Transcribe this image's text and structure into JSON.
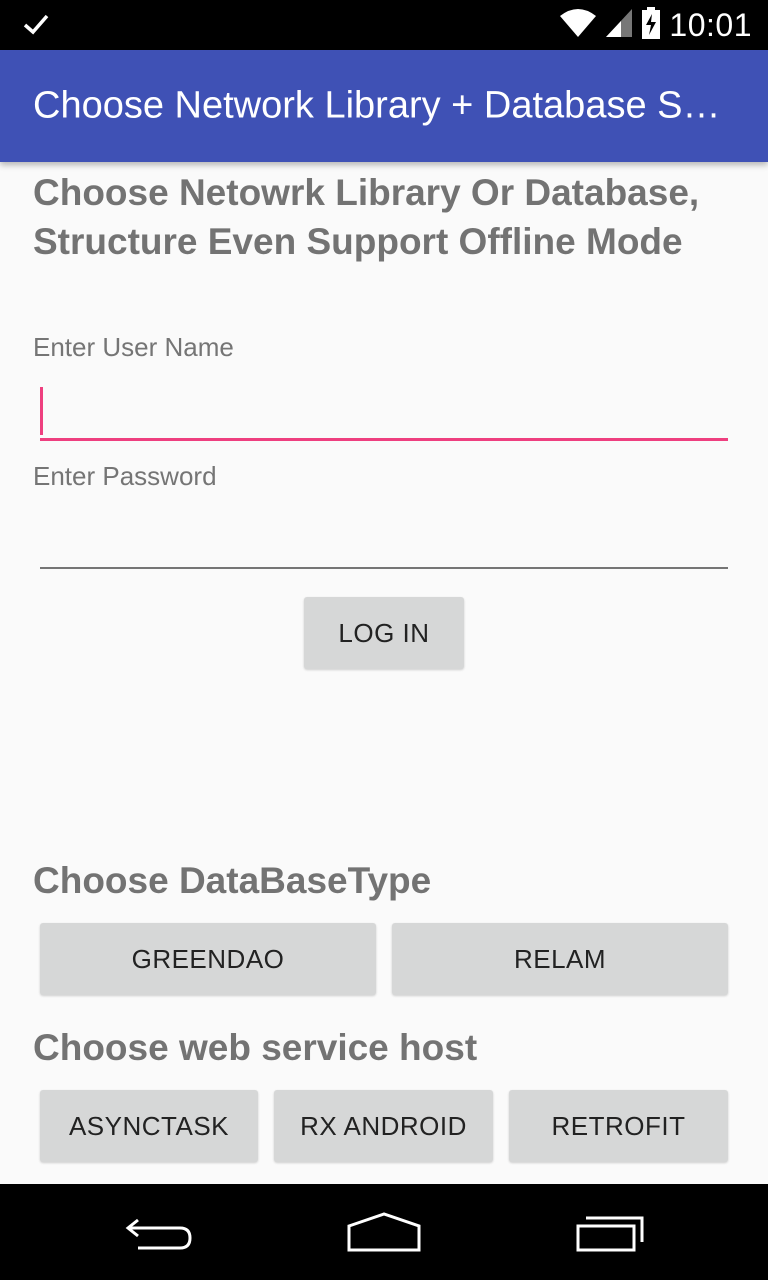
{
  "status_bar": {
    "time": "10:01",
    "icons": [
      "check-icon",
      "wifi-icon",
      "signal-icon",
      "battery-charging-icon"
    ]
  },
  "app_bar": {
    "title": "Choose Network Library + Database Structure"
  },
  "main": {
    "title": "Choose Netowrk Library Or Database, Structure Even Support Offline Mode",
    "username": {
      "label": "Enter User Name",
      "value": ""
    },
    "password": {
      "label": "Enter Password",
      "value": ""
    },
    "login_button": "LOG IN"
  },
  "database_section": {
    "title": "Choose DataBaseType",
    "options": [
      "GREENDAO",
      "RELAM"
    ]
  },
  "webservice_section": {
    "title": "Choose web service host",
    "options": [
      "ASYNCTASK",
      "RX ANDROID",
      "RETROFIT"
    ]
  },
  "nav_bar": {
    "icons": [
      "back-icon",
      "home-icon",
      "recents-icon"
    ]
  },
  "colors": {
    "primary": "#3f51b5",
    "accent": "#ee3f7f",
    "button": "#d6d7d7"
  }
}
